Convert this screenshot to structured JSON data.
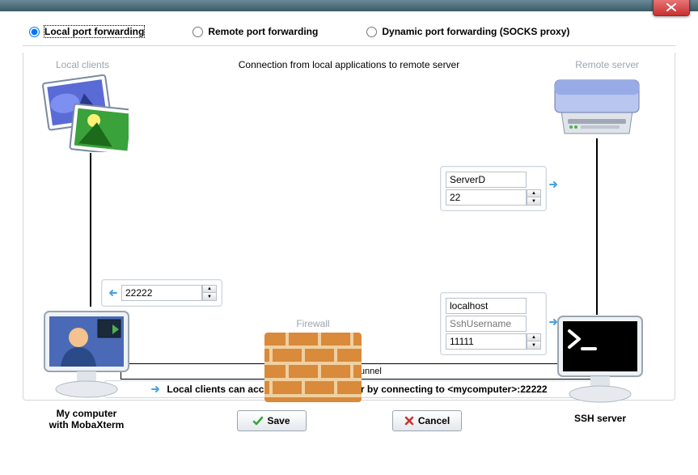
{
  "tabs": {
    "local": "Local port forwarding",
    "remote": "Remote port forwarding",
    "dynamic": "Dynamic port forwarding (SOCKS proxy)",
    "selected": "local"
  },
  "labels": {
    "local_clients": "Local clients",
    "remote_server": "Remote server",
    "description": "Connection from local applications to remote server",
    "firewall": "Firewall",
    "ssh_tunnel": "SSH tunnel",
    "my_computer": "My computer",
    "with_moba": "with MobaXterm",
    "ssh_server": "SSH server"
  },
  "fields": {
    "local_port": "22222",
    "remote_host": "ServerD",
    "remote_port": "22",
    "ssh_host": "localhost",
    "ssh_user_placeholder": "SshUsername",
    "ssh_port": "11111"
  },
  "status": {
    "text": "Local clients can access the remote server by connecting to <mycomputer>:22222"
  },
  "buttons": {
    "save": "Save",
    "cancel": "Cancel"
  }
}
